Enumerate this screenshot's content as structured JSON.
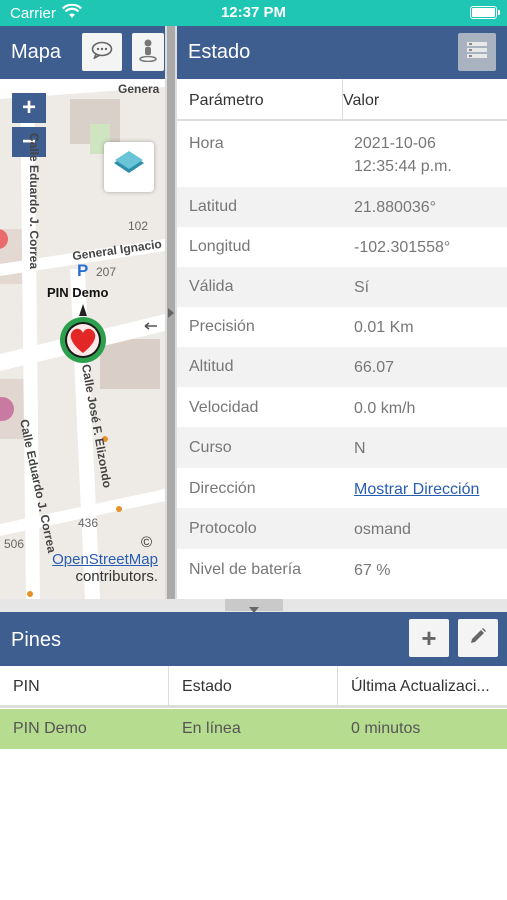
{
  "status_bar": {
    "carrier": "Carrier",
    "time": "12:37 PM"
  },
  "map_panel": {
    "title": "Mapa",
    "zoom_in": "+",
    "zoom_out": "−",
    "labels": {
      "genera_top": "Genera",
      "general_ignacio": "General Ignacio",
      "calle_eduardo_top": "Calle Eduardo J. Correa",
      "calle_eduardo_bottom": "Calle Eduardo J. Correa",
      "calle_jose": "Calle José F. Elizondo",
      "num_102": "102",
      "num_207": "207",
      "num_436": "436",
      "num_506": "506",
      "parking": "P"
    },
    "pin_label": "PIN Demo",
    "attribution_symbol": "©",
    "attribution_link": "OpenStreetMap",
    "attribution_suffix": "contributors."
  },
  "status_panel": {
    "title": "Estado",
    "columns": [
      "Parámetro",
      "Valor"
    ],
    "rows": [
      {
        "param": "Hora",
        "value_line1": "2021-10-06",
        "value_line2": "12:35:44 p.m."
      },
      {
        "param": "Latitud",
        "value": "21.880036°"
      },
      {
        "param": "Longitud",
        "value": "-102.301558°"
      },
      {
        "param": "Válida",
        "value": "Sí"
      },
      {
        "param": "Precisión",
        "value": "0.01 Km"
      },
      {
        "param": "Altitud",
        "value": "66.07"
      },
      {
        "param": "Velocidad",
        "value": "0.0 km/h"
      },
      {
        "param": "Curso",
        "value": "N"
      },
      {
        "param": "Dirección",
        "value": "Mostrar Dirección"
      },
      {
        "param": "Protocolo",
        "value": "osmand"
      },
      {
        "param": "Nivel de batería",
        "value": "67 %"
      }
    ]
  },
  "pins_panel": {
    "title": "Pines",
    "add_label": "+",
    "columns": [
      "PIN",
      "Estado",
      "Última Actualizaci..."
    ],
    "rows": [
      {
        "pin": "PIN Demo",
        "estado": "En línea",
        "updated": "0 minutos"
      }
    ]
  },
  "colors": {
    "status_bar": "#1fc6b4",
    "header": "#3e5e8f",
    "selected_row": "#b6dc8f",
    "link": "#2a5db0",
    "pin_green": "#2ca04c",
    "pin_heart": "#e32626"
  },
  "icons": {
    "wifi": "wifi-icon",
    "battery": "battery-icon",
    "chat": "chat-bubble-icon",
    "person": "person-pin-icon",
    "list": "list-view-icon",
    "layers": "layers-icon",
    "marker": "heart-marker-icon",
    "edit": "pencil-icon",
    "collapse": "chevron-down-icon",
    "expand": "chevron-right-icon"
  }
}
